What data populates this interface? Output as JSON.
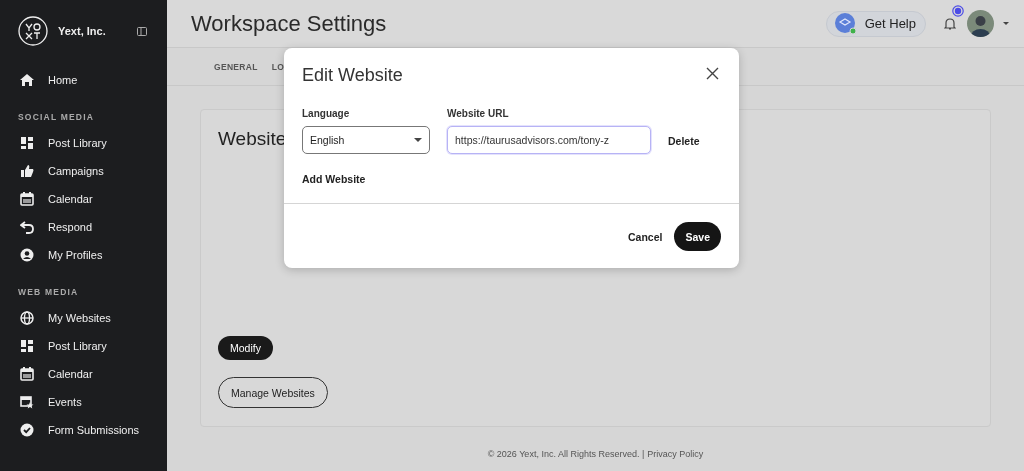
{
  "sidebar": {
    "org_name": "Yext, Inc.",
    "home": {
      "label": "Home"
    },
    "sections": [
      {
        "heading": "SOCIAL MEDIA",
        "items": [
          {
            "label": "Post Library"
          },
          {
            "label": "Campaigns"
          },
          {
            "label": "Calendar"
          },
          {
            "label": "Respond"
          },
          {
            "label": "My Profiles"
          }
        ]
      },
      {
        "heading": "WEB MEDIA",
        "items": [
          {
            "label": "My Websites"
          },
          {
            "label": "Post Library"
          },
          {
            "label": "Calendar"
          },
          {
            "label": "Events"
          },
          {
            "label": "Form Submissions"
          }
        ]
      }
    ]
  },
  "header": {
    "title": "Workspace Settings",
    "help_button": "Get Help",
    "notification_unread": true
  },
  "tabs": [
    {
      "label": "GENERAL"
    },
    {
      "label": "LO"
    }
  ],
  "card": {
    "title": "Website",
    "buttons": [
      {
        "label": "Modify",
        "kind": "filled"
      },
      {
        "label": "Manage Websites",
        "kind": "outlined"
      }
    ]
  },
  "footer": {
    "text": "© 2026 Yext, Inc. All Rights Reserved. |",
    "link": "Privacy Policy"
  },
  "dialog": {
    "title": "Edit Website",
    "language_label": "Language",
    "language_value": "English",
    "url_label": "Website URL",
    "url_value": "https://taurusadvisors.com/tony-z",
    "url_focused": true,
    "delete": "Delete",
    "add": "Add Website",
    "cancel": "Cancel",
    "save": "Save"
  }
}
